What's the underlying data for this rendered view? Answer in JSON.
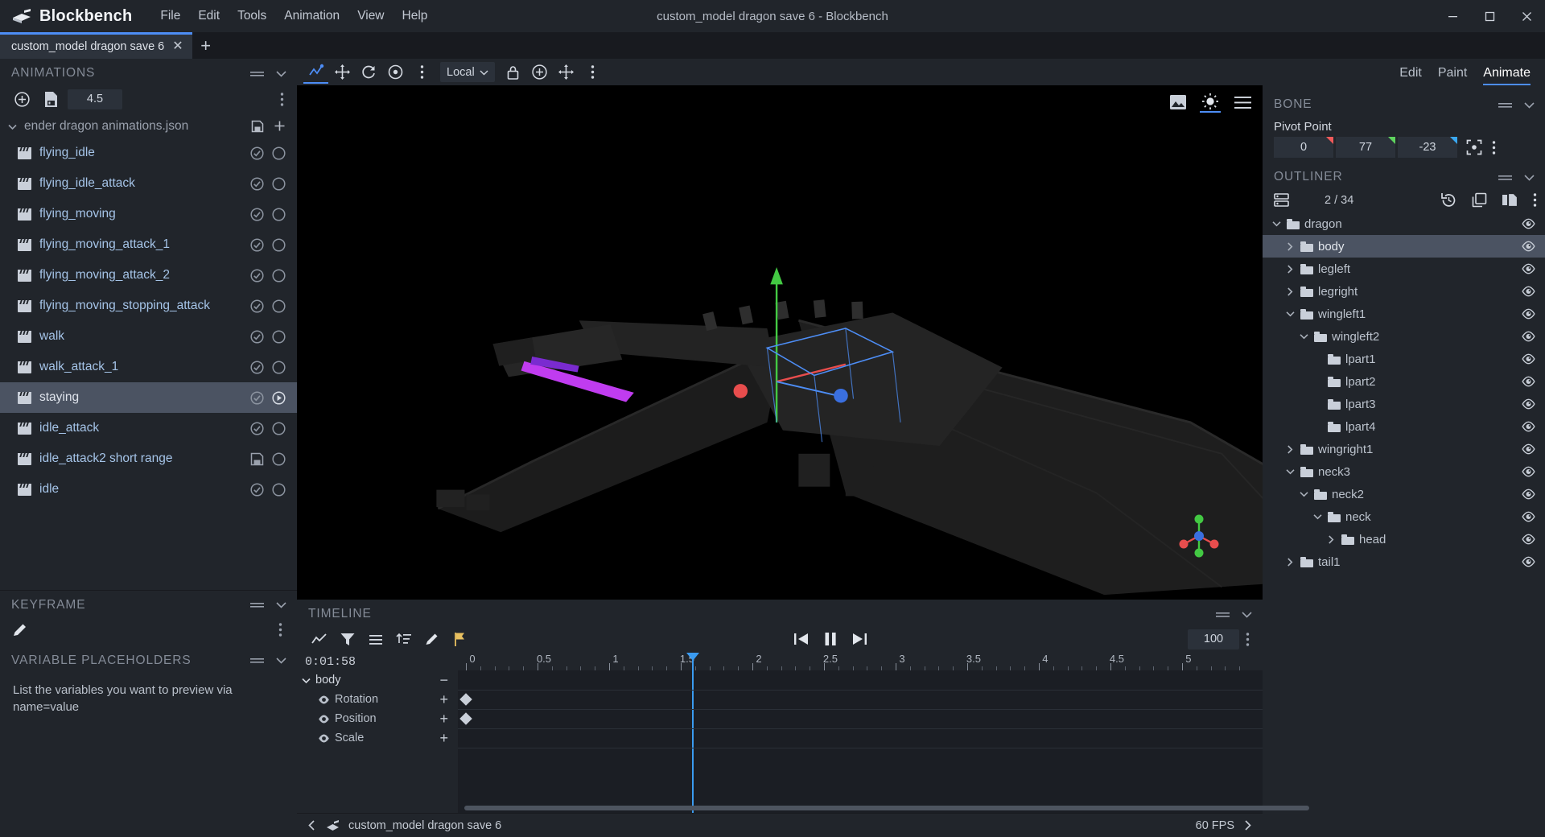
{
  "app": {
    "name": "Blockbench",
    "window_title": "custom_model dragon save 6 - Blockbench",
    "menus": [
      "File",
      "Edit",
      "Tools",
      "Animation",
      "View",
      "Help"
    ],
    "window_buttons": {
      "minimize": "minimize-icon",
      "maximize": "maximize-icon",
      "close": "close-icon"
    }
  },
  "tabbar": {
    "project_tab": "custom_model dragon save 6",
    "close_label": "✕",
    "add_label": "+"
  },
  "left": {
    "animations_panel": {
      "title": "ANIMATIONS",
      "toolbar": {
        "add_icon": "add-animation-icon",
        "file_icon": "save-file-icon",
        "length_value": "4.5",
        "menu_icon": "overflow-menu-icon"
      },
      "file": {
        "name": "ender dragon animations.json",
        "save_icon": "save-icon",
        "add_icon": "plus-icon"
      },
      "items": [
        {
          "label": "flying_idle",
          "selected": false,
          "saved": "check",
          "play": "circle"
        },
        {
          "label": "flying_idle_attack",
          "selected": false,
          "saved": "check",
          "play": "circle"
        },
        {
          "label": "flying_moving",
          "selected": false,
          "saved": "check",
          "play": "circle"
        },
        {
          "label": "flying_moving_attack_1",
          "selected": false,
          "saved": "check",
          "play": "circle"
        },
        {
          "label": "flying_moving_attack_2",
          "selected": false,
          "saved": "check",
          "play": "circle"
        },
        {
          "label": "flying_moving_stopping_attack",
          "selected": false,
          "saved": "check",
          "play": "circle"
        },
        {
          "label": "walk",
          "selected": false,
          "saved": "check",
          "play": "circle"
        },
        {
          "label": "walk_attack_1",
          "selected": false,
          "saved": "check",
          "play": "circle"
        },
        {
          "label": "staying",
          "selected": true,
          "saved": "check",
          "play": "play"
        },
        {
          "label": "idle_attack",
          "selected": false,
          "saved": "check",
          "play": "circle"
        },
        {
          "label": "idle_attack2 short range",
          "selected": false,
          "saved": "disk",
          "play": "circle"
        },
        {
          "label": "idle",
          "selected": false,
          "saved": "check",
          "play": "circle"
        }
      ]
    },
    "keyframe_panel": {
      "title": "KEYFRAME",
      "edit_icon": "pencil-icon",
      "menu_icon": "overflow-menu-icon"
    },
    "variable_panel": {
      "title": "VARIABLE PLACEHOLDERS",
      "placeholder_line1": "List the variables you want to preview via",
      "placeholder_line2": "name=value"
    }
  },
  "viewport_toolbar": {
    "tools": [
      "animate-tool-icon",
      "move-tool-icon",
      "rotate-tool-icon",
      "pivot-tool-icon",
      "overflow-menu-icon"
    ],
    "space_select": "Local",
    "lock_icon": "lock-icon",
    "add_icon": "add-icon",
    "resize_icon": "resize-icon",
    "more_icon": "overflow-menu-icon",
    "corner": [
      "image-icon",
      "brightness-icon",
      "panel-menu-icon"
    ]
  },
  "timeline": {
    "title": "TIMELINE",
    "tools": [
      "graph-editor-icon",
      "filter-icon",
      "align-icon",
      "sort-icon",
      "edit-icon",
      "flag-icon"
    ],
    "playback": {
      "jump_start_icon": "skip-previous-icon",
      "pause_icon": "pause-icon",
      "jump_end_icon": "skip-next-icon"
    },
    "zoom_value": "100",
    "menu_icon": "overflow-menu-icon",
    "time_code": "0:01:58",
    "ruler_labels": [
      "0",
      "0.5",
      "1",
      "1.5",
      "2",
      "2.5",
      "3",
      "3.5",
      "4",
      "4.5",
      "5"
    ],
    "playhead_time": 1.58,
    "bone": {
      "name": "body",
      "collapse_icon": "chevron-down-icon",
      "minus": "−"
    },
    "channels": [
      {
        "label": "Rotation",
        "plus": "+",
        "keyframes": [
          0
        ]
      },
      {
        "label": "Position",
        "plus": "+",
        "keyframes": [
          0
        ]
      },
      {
        "label": "Scale",
        "plus": "+",
        "keyframes": []
      }
    ]
  },
  "statusbar": {
    "prev_icon": "chevron-left-icon",
    "format_icon": "format-icon",
    "project_name": "custom_model dragon save 6",
    "fps": "60 FPS",
    "next_icon": "chevron-right-icon"
  },
  "right": {
    "mode_tabs": [
      {
        "label": "Edit",
        "active": false
      },
      {
        "label": "Paint",
        "active": false
      },
      {
        "label": "Animate",
        "active": true
      }
    ],
    "bone_panel": {
      "title": "BONE",
      "pivot_label": "Pivot Point",
      "pivot": [
        {
          "value": "0",
          "axis_color": "#f05a5a"
        },
        {
          "value": "77",
          "axis_color": "#5ed35e"
        },
        {
          "value": "-23",
          "axis_color": "#3aa8f0"
        }
      ],
      "center_icon": "center-pivot-icon",
      "menu_icon": "overflow-menu-icon",
      "collapse_icon": "chevron-down-icon",
      "drag_icon": "drag-handle-icon"
    },
    "outliner_panel": {
      "title": "OUTLINER",
      "list_icon": "list-view-icon",
      "count": "2 / 34",
      "history_icon": "history-icon",
      "copy_icon": "copy-icon",
      "duplicate_icon": "duplicate-icon",
      "menu_icon": "overflow-menu-icon",
      "collapse_icon": "chevron-down-icon",
      "drag_icon": "drag-handle-icon",
      "tree": [
        {
          "label": "dragon",
          "depth": 0,
          "caret": "down",
          "selected": false
        },
        {
          "label": "body",
          "depth": 1,
          "caret": "right",
          "selected": true
        },
        {
          "label": "legleft",
          "depth": 1,
          "caret": "right",
          "selected": false
        },
        {
          "label": "legright",
          "depth": 1,
          "caret": "right",
          "selected": false
        },
        {
          "label": "wingleft1",
          "depth": 1,
          "caret": "down",
          "selected": false
        },
        {
          "label": "wingleft2",
          "depth": 2,
          "caret": "down",
          "selected": false
        },
        {
          "label": "lpart1",
          "depth": 3,
          "caret": "none",
          "selected": false
        },
        {
          "label": "lpart2",
          "depth": 3,
          "caret": "none",
          "selected": false
        },
        {
          "label": "lpart3",
          "depth": 3,
          "caret": "none",
          "selected": false
        },
        {
          "label": "lpart4",
          "depth": 3,
          "caret": "none",
          "selected": false
        },
        {
          "label": "wingright1",
          "depth": 1,
          "caret": "right",
          "selected": false
        },
        {
          "label": "neck3",
          "depth": 1,
          "caret": "down",
          "selected": false
        },
        {
          "label": "neck2",
          "depth": 2,
          "caret": "down",
          "selected": false
        },
        {
          "label": "neck",
          "depth": 3,
          "caret": "down",
          "selected": false
        },
        {
          "label": "head",
          "depth": 4,
          "caret": "right",
          "selected": false
        },
        {
          "label": "tail1",
          "depth": 1,
          "caret": "right",
          "selected": false
        }
      ]
    }
  },
  "colors": {
    "accent": "#4d8df5",
    "panel_bg": "#21252b",
    "dark_bg": "#181a1f",
    "selected_row": "#4b5362",
    "text": "#c8ccd4",
    "link_text": "#a5c4e8",
    "axis_x": "#f05a5a",
    "axis_y": "#5ed35e",
    "axis_z": "#3aa8f0"
  }
}
